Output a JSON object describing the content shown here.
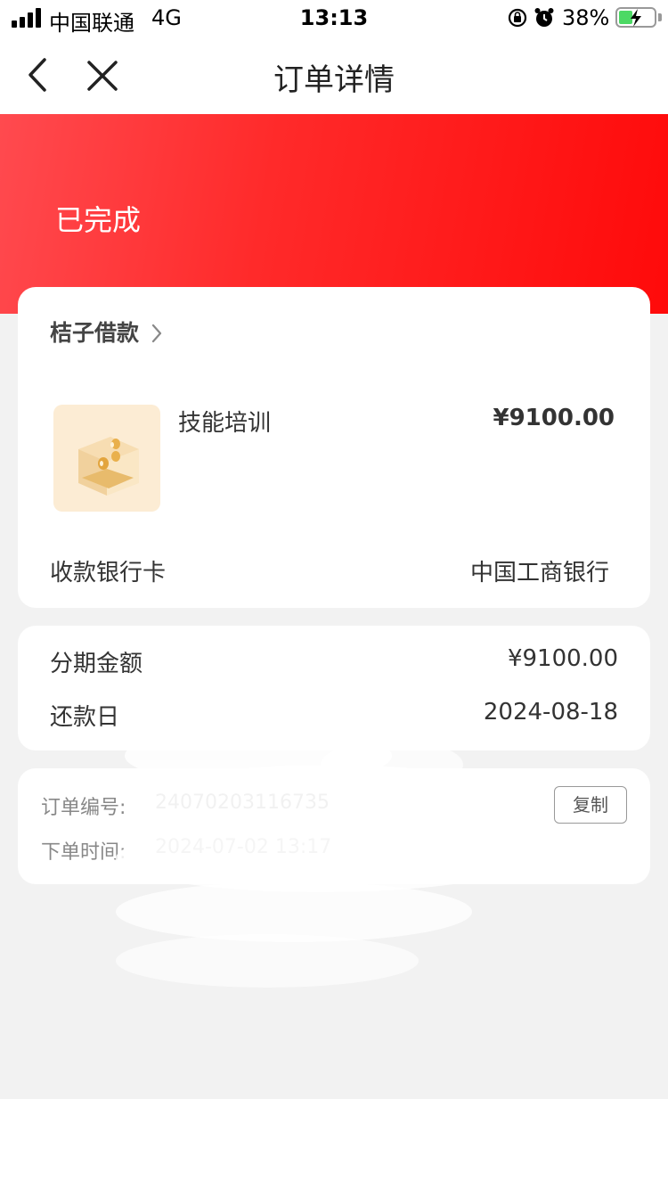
{
  "status_bar": {
    "carrier": "中国联通",
    "network": "4G",
    "time": "13:13",
    "battery_percent": "38%",
    "icons": [
      "signal-icon",
      "rotation-lock-icon",
      "alarm-icon",
      "battery-charging-icon"
    ]
  },
  "nav": {
    "title": "订单详情",
    "back_icon": "chevron-left-icon",
    "close_icon": "close-icon"
  },
  "order_status": "已完成",
  "merchant": {
    "name": "桔子借款",
    "arrow_icon": "chevron-right-icon"
  },
  "product": {
    "name": "技能培训",
    "price": "¥9100.00",
    "image_icon": "coin-box-icon"
  },
  "bank": {
    "label": "收款银行卡",
    "value": "中国工商银行"
  },
  "plan": {
    "amount_label": "分期金额",
    "amount_value": "¥9100.00",
    "due_label": "还款日",
    "due_value": "2024-08-18"
  },
  "order": {
    "number_label": "订单编号:",
    "number_value": "24070203116735",
    "time_label": "下单时间:",
    "time_value": "2024-07-02 13:17",
    "copy_label": "复制"
  },
  "colors": {
    "hero_start": "#ff4a4f",
    "hero_end": "#ff0a0a",
    "page_bg": "#f2f2f2"
  }
}
